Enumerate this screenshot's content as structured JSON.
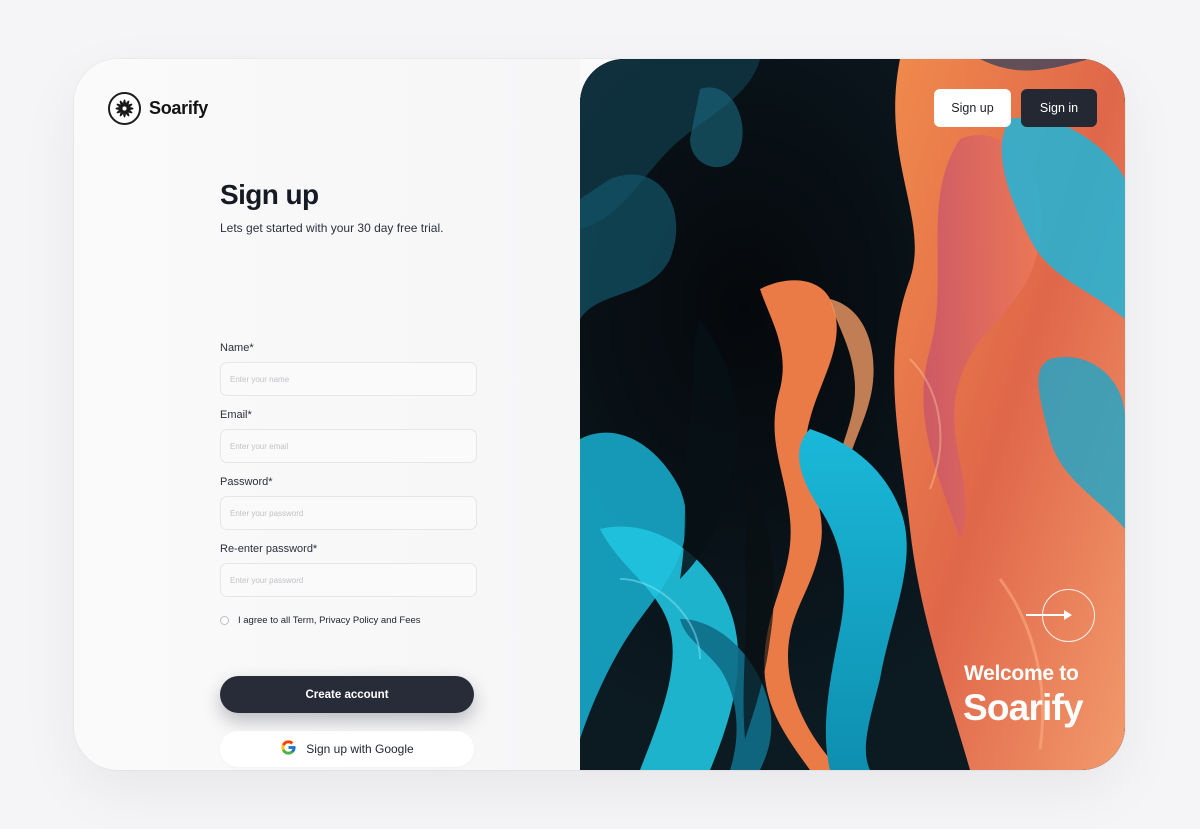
{
  "brand": {
    "name": "Soarify"
  },
  "signup": {
    "title": "Sign up",
    "subtitle": "Lets get started with your 30 day free trial.",
    "fields": [
      {
        "label": "Name*",
        "placeholder": "Enter your name"
      },
      {
        "label": "Email*",
        "placeholder": "Enter your email"
      },
      {
        "label": "Password*",
        "placeholder": "Enter your password"
      },
      {
        "label": "Re-enter password*",
        "placeholder": "Enter your password"
      }
    ],
    "agree_text": "I agree to all Term, Privacy Policy and Fees",
    "create_button": "Create account",
    "google_button": "Sign up with Google"
  },
  "hero": {
    "nav_signup": "Sign up",
    "nav_signin": "Sign in",
    "welcome_line": "Welcome to",
    "brand_line": "Soarify"
  },
  "colors": {
    "primary_dark": "#282c38",
    "accent_orange": "#e97a45",
    "accent_cyan": "#16b6d6"
  },
  "icons": [
    "logo-icon",
    "google-icon",
    "arrow-right-icon"
  ]
}
